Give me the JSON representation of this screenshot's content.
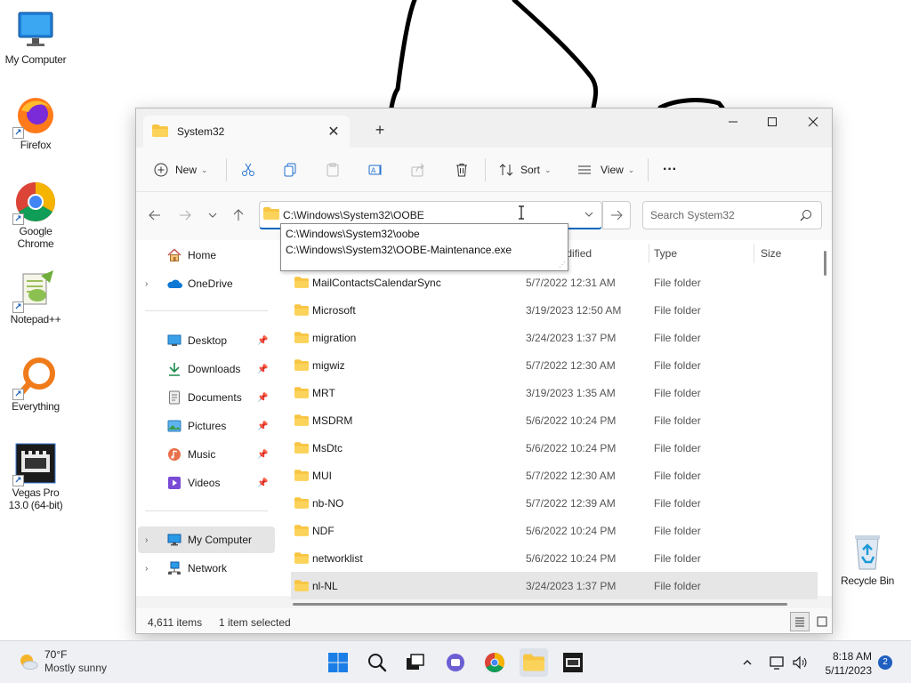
{
  "desktop": {
    "icons": [
      {
        "label": "My Computer"
      },
      {
        "label": "Firefox"
      },
      {
        "label": "Google Chrome"
      },
      {
        "label": "Notepad++"
      },
      {
        "label": "Everything"
      },
      {
        "label": "Vegas Pro 13.0 (64-bit)"
      },
      {
        "label": "Recycle Bin"
      }
    ]
  },
  "window": {
    "tab_title": "System32",
    "tab_close": "✕",
    "new_tab": "+",
    "controls": {
      "minimize": "—",
      "maximize": "☐",
      "close": "✕"
    },
    "toolbar": {
      "new_label": "New",
      "sort_label": "Sort",
      "view_label": "View",
      "more_label": "···"
    },
    "address": {
      "value": "C:\\Windows\\System32\\OOBE",
      "suggestions": [
        "C:\\Windows\\System32\\oobe",
        "C:\\Windows\\System32\\OOBE-Maintenance.exe"
      ]
    },
    "search": {
      "placeholder": "Search System32"
    },
    "sidebar": {
      "home": "Home",
      "onedrive": "OneDrive",
      "quick": [
        "Desktop",
        "Downloads",
        "Documents",
        "Pictures",
        "Music",
        "Videos"
      ],
      "my_computer": "My Computer",
      "network": "Network"
    },
    "columns": {
      "date": "Date modified",
      "type": "Type",
      "size": "Size"
    },
    "files": [
      {
        "name": "MailContactsCalendarSync",
        "date": "5/7/2022 12:31 AM",
        "type": "File folder"
      },
      {
        "name": "Microsoft",
        "date": "3/19/2023 12:50 AM",
        "type": "File folder"
      },
      {
        "name": "migration",
        "date": "3/24/2023 1:37 PM",
        "type": "File folder"
      },
      {
        "name": "migwiz",
        "date": "5/7/2022 12:30 AM",
        "type": "File folder"
      },
      {
        "name": "MRT",
        "date": "3/19/2023 1:35 AM",
        "type": "File folder"
      },
      {
        "name": "MSDRM",
        "date": "5/6/2022 10:24 PM",
        "type": "File folder"
      },
      {
        "name": "MsDtc",
        "date": "5/6/2022 10:24 PM",
        "type": "File folder"
      },
      {
        "name": "MUI",
        "date": "5/7/2022 12:30 AM",
        "type": "File folder"
      },
      {
        "name": "nb-NO",
        "date": "5/7/2022 12:39 AM",
        "type": "File folder"
      },
      {
        "name": "NDF",
        "date": "5/6/2022 10:24 PM",
        "type": "File folder"
      },
      {
        "name": "networklist",
        "date": "5/6/2022 10:24 PM",
        "type": "File folder"
      },
      {
        "name": "nl-NL",
        "date": "3/24/2023 1:37 PM",
        "type": "File folder"
      }
    ],
    "status": {
      "items": "4,611 items",
      "selected": "1 item selected"
    }
  },
  "taskbar": {
    "weather_temp": "70°F",
    "weather_cond": "Mostly sunny",
    "time": "8:18 AM",
    "date": "5/11/2023",
    "notifications": "2"
  },
  "colors": {
    "accent": "#0067c0",
    "folder": "#f8c543",
    "selected_row": "#e6e6e6"
  }
}
